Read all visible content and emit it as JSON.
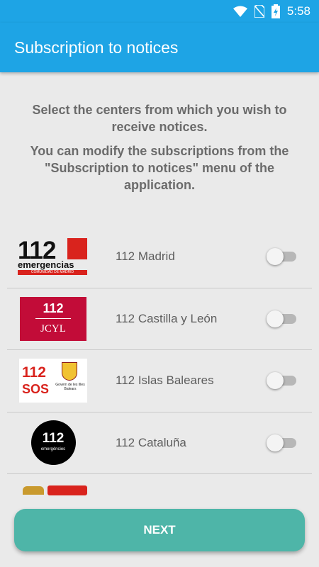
{
  "status_bar": {
    "time": "5:58",
    "icons": [
      "wifi-icon",
      "no-sim-icon",
      "battery-charging-icon"
    ]
  },
  "app_bar": {
    "title": "Subscription to notices"
  },
  "intro": {
    "line1": "Select the centers from which you wish to receive notices.",
    "line2": "You can modify the subscriptions from the \"Subscription to notices\" menu of the application."
  },
  "centers": [
    {
      "label": "112 Madrid",
      "enabled": false,
      "logo_number": "112",
      "logo_text": "emergencias",
      "logo_subtext": "COMUNIDAD DE MADRID"
    },
    {
      "label": "112 Castilla y León",
      "enabled": false,
      "logo_number": "112",
      "logo_text": "JCYL"
    },
    {
      "label": "112 Islas Baleares",
      "enabled": false,
      "logo_number": "112",
      "logo_text": "SOS",
      "logo_subtext": "Govern de les Illes Balears"
    },
    {
      "label": "112 Cataluña",
      "enabled": false,
      "logo_number": "112",
      "logo_text": "emergències"
    }
  ],
  "next_button": {
    "label": "NEXT"
  },
  "colors": {
    "app_bar": "#1ea4e5",
    "button": "#4eb5a8",
    "background": "#eaeaea"
  }
}
